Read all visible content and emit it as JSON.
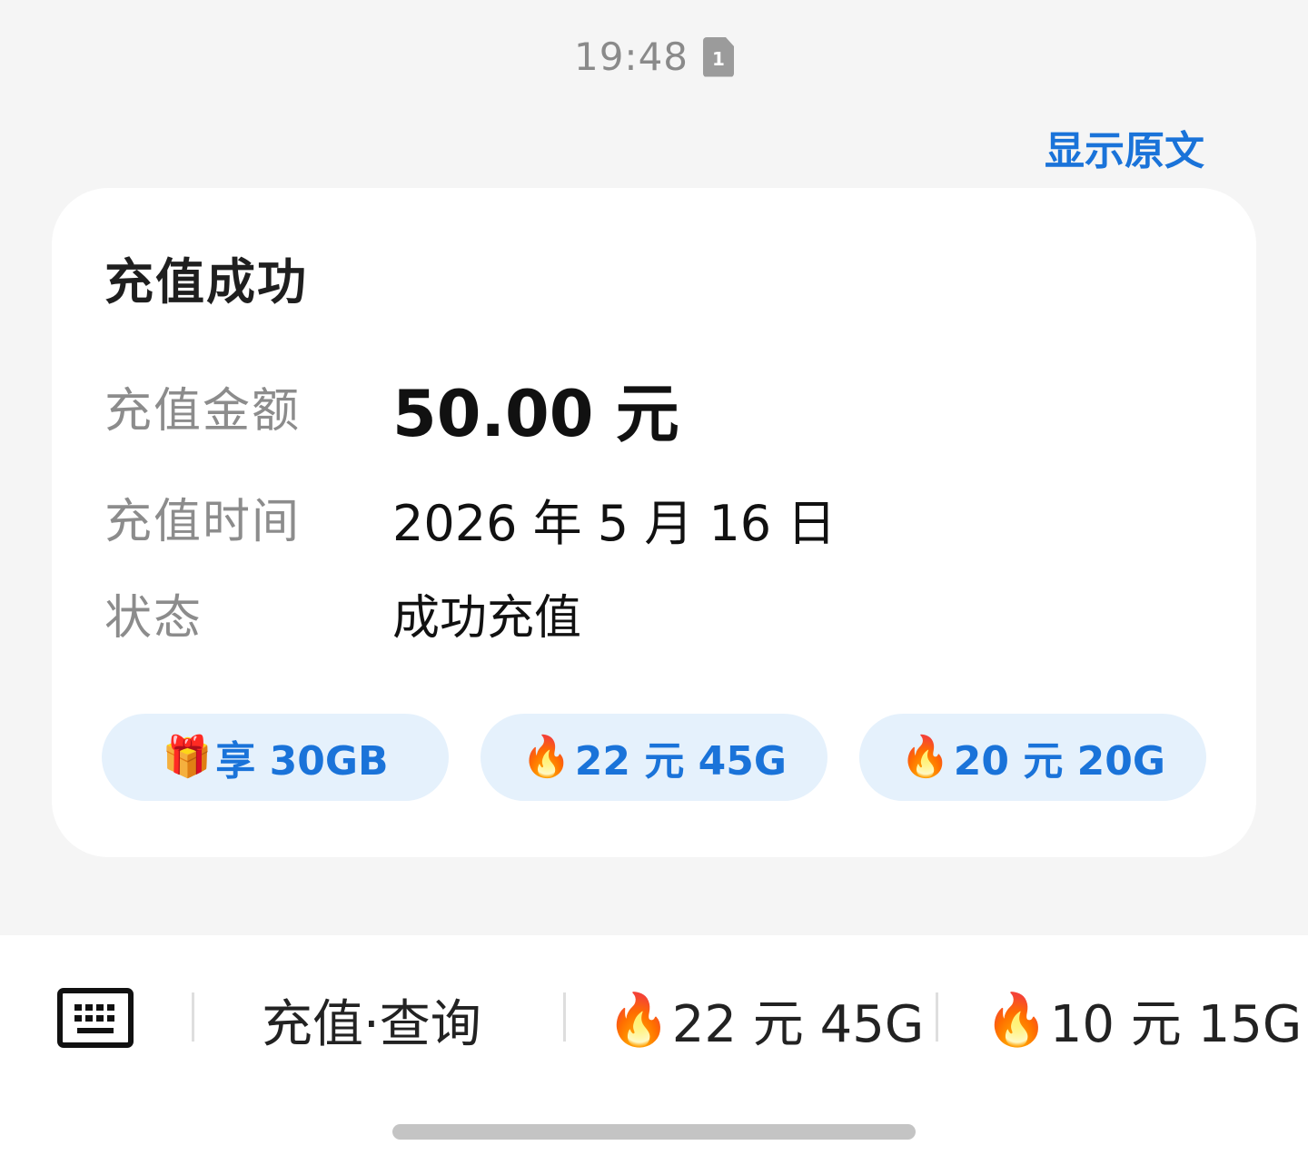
{
  "message": {
    "time": "19:48",
    "sim_slot": "1",
    "show_original": "显示原文"
  },
  "card": {
    "title": "充值成功",
    "rows": [
      {
        "label": "充值金额",
        "value": "50.00 元"
      },
      {
        "label": "充值时间",
        "value": "2026 年 5 月 16 日"
      },
      {
        "label": "状态",
        "value": "成功充值"
      }
    ],
    "chips": [
      {
        "icon": "🎁",
        "icon_name": "gift-icon",
        "label": "享 30GB"
      },
      {
        "icon": "🔥",
        "icon_name": "fire-icon",
        "label": "22 元 45G"
      },
      {
        "icon": "🔥",
        "icon_name": "fire-icon",
        "label": "20 元 20G"
      }
    ]
  },
  "menu": {
    "keyboard_icon": "keyboard-icon",
    "items": [
      {
        "icon": "",
        "label": "充值·查询"
      },
      {
        "icon": "🔥",
        "label": "22 元 45G"
      },
      {
        "icon": "🔥",
        "label": "10 元 15G"
      }
    ]
  },
  "colors": {
    "accent": "#1a73d9",
    "chip_bg": "#e5f1fc",
    "page_bg": "#f5f5f5"
  }
}
